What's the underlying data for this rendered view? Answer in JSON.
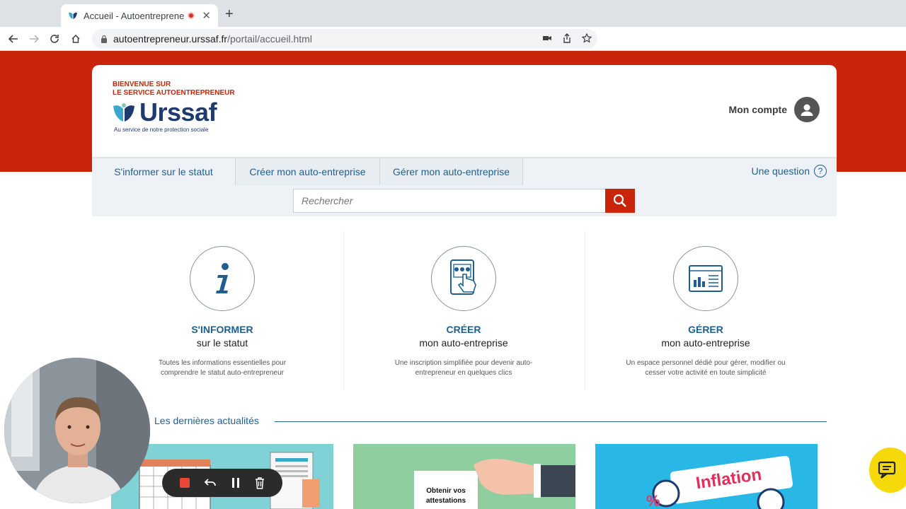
{
  "browser": {
    "tab_title": "Accueil - Autoentrepreneur",
    "url_host": "autoentrepreneur.urssaf.fr",
    "url_path": "/portail/accueil.html"
  },
  "header": {
    "welcome_line1": "BIENVENUE SUR",
    "welcome_line2": "LE SERVICE AUTOENTREPRENEUR",
    "logo_text": "Urssaf",
    "logo_tagline": "Au service de notre protection sociale",
    "account_label": "Mon compte"
  },
  "nav": {
    "items": [
      {
        "label": "S'informer sur le statut"
      },
      {
        "label": "Créer mon auto-entreprise"
      },
      {
        "label": "Gérer mon auto-entreprise"
      }
    ],
    "question_label": "Une question",
    "question_mark": "?"
  },
  "search": {
    "placeholder": "Rechercher"
  },
  "features": [
    {
      "title": "S'INFORMER",
      "subtitle": "sur le statut",
      "description": "Toutes les informations essentielles pour comprendre le statut auto-entrepreneur"
    },
    {
      "title": "CRÉER",
      "subtitle": "mon auto-entreprise",
      "description": "Une inscription simplifiée pour devenir auto-entrepreneur en quelques clics"
    },
    {
      "title": "GÉRER",
      "subtitle": "mon auto-entreprise",
      "description": "Un espace personnel dédié pour gérer, modifier ou cesser votre activité en toute simplicité"
    }
  ],
  "news": {
    "title": "Les dernières actualités",
    "card2_text_line1": "Obtenir vos",
    "card2_text_line2": "attestations",
    "card3_text": "Inflation"
  },
  "colors": {
    "brand_red": "#c8250a",
    "brand_blue": "#1e5f8f",
    "logo_navy": "#1e3a6e"
  }
}
